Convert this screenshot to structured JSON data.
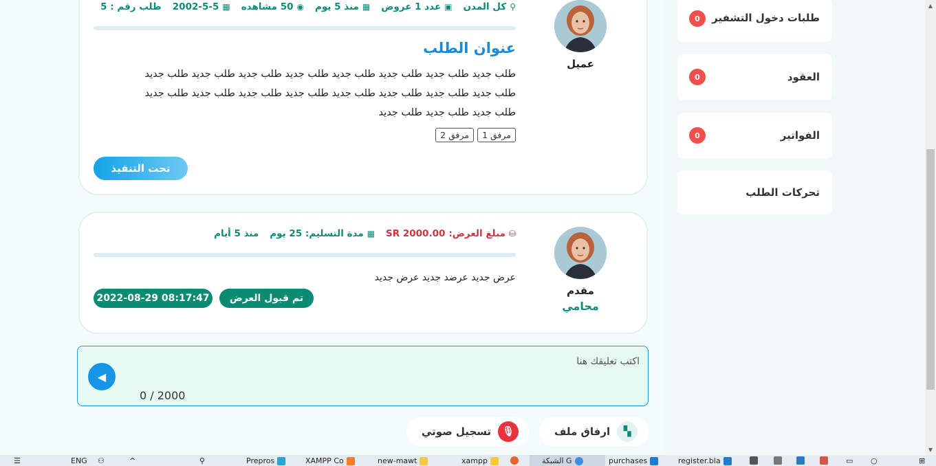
{
  "request": {
    "role": "عميل",
    "meta": {
      "number": "طلب رقم : 5",
      "date": "2002-5-5",
      "views": "50 مشاهده",
      "age": "منذ 5 يوم",
      "offers": "عدد 1 عروض",
      "city": "كل المدن"
    },
    "title": "عنوان الطلب",
    "body_lines": [
      "طلب جديد طلب جديد طلب جديد طلب جديد طلب جديد طلب جديد طلب جديد طلب جديد",
      "طلب جديد طلب جديد طلب جديد طلب جديد طلب جديد طلب جديد طلب جديد طلب جديد",
      "طلب جديد طلب جديد طلب جديد"
    ],
    "attachments": [
      "مرفق 1",
      "مرفق 2"
    ],
    "status": "تحت التنفيذ"
  },
  "offer": {
    "role": "مقدم",
    "role_sub": "محامي",
    "meta": {
      "age": "منذ 5 أيام",
      "delivery": "مدة التسليم: 25 يوم",
      "amount_label": "مبلغ العرض:",
      "amount": "SR 2000.00"
    },
    "text": "عرض جديد عرضد جديد عرض جديد",
    "accepted": "تم قبول العرض",
    "timestamp": "2022-08-29 08:17:47"
  },
  "comment": {
    "placeholder": "اكتب تعليقك هنا",
    "counter": "0 / 2000"
  },
  "actions": {
    "attach_file": "ارفاق ملف",
    "voice_record": "تسجيل صوتي"
  },
  "sidebar": {
    "items": [
      {
        "label": "طلبات دخول التشفير",
        "badge": "0"
      },
      {
        "label": "العقود",
        "badge": "0"
      },
      {
        "label": "الفواتير",
        "badge": "0"
      },
      {
        "label": "تحركات الطلب"
      }
    ]
  },
  "colors": {
    "accent_teal": "#0d8b77",
    "accent_blue": "#1a8ad6",
    "price_red": "#d0343f",
    "badge_red": "#f0504b",
    "voice_red": "#e8333c"
  },
  "taskbar": {
    "lang": "ENG",
    "items": [
      "Prepros",
      "XAMPP Co",
      "new-mawt",
      "xampp",
      "الشبكة G",
      "purchases",
      "register.bla"
    ]
  }
}
